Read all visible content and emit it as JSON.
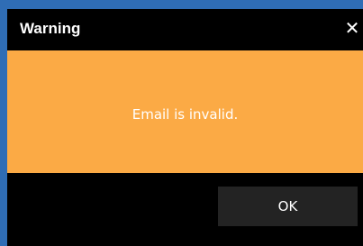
{
  "dialog": {
    "title": "Warning",
    "close_icon": "close-icon",
    "close_symbol": "✕",
    "message": "Email is invalid.",
    "ok_label": "OK"
  },
  "colors": {
    "background": "#2f6db5",
    "dialog_background": "#000000",
    "message_background": "#fbaa45",
    "button_background": "#232323",
    "text": "#ffffff"
  }
}
